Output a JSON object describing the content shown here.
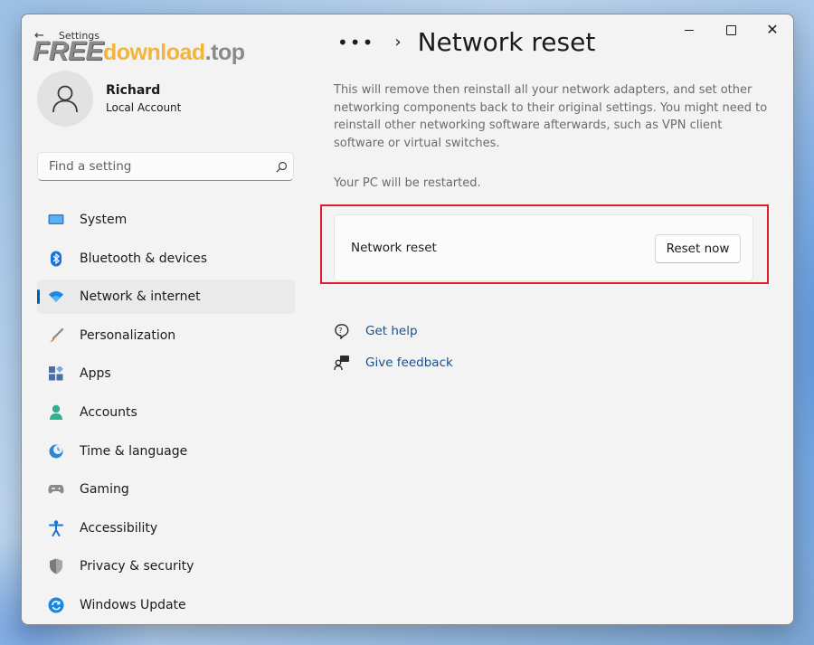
{
  "window": {
    "title": "Settings"
  },
  "watermark": {
    "part1": "FREE",
    "part2": "download",
    "part3": ".top"
  },
  "profile": {
    "name": "Richard",
    "account_type": "Local Account"
  },
  "search": {
    "placeholder": "Find a setting"
  },
  "sidebar": {
    "items": [
      {
        "label": "System",
        "icon": "system-icon",
        "color": "#2f7fd0"
      },
      {
        "label": "Bluetooth & devices",
        "icon": "bluetooth-icon",
        "color": "#1a73d9"
      },
      {
        "label": "Network & internet",
        "icon": "wifi-icon",
        "color": "#1a86e0",
        "active": true
      },
      {
        "label": "Personalization",
        "icon": "brush-icon",
        "color": "#d87a3a"
      },
      {
        "label": "Apps",
        "icon": "apps-icon",
        "color": "#4a6fa8"
      },
      {
        "label": "Accounts",
        "icon": "accounts-icon",
        "color": "#2fb08f"
      },
      {
        "label": "Time & language",
        "icon": "clock-globe-icon",
        "color": "#2a86d6"
      },
      {
        "label": "Gaming",
        "icon": "gamepad-icon",
        "color": "#8a8a8a"
      },
      {
        "label": "Accessibility",
        "icon": "accessibility-icon",
        "color": "#1a73d9"
      },
      {
        "label": "Privacy & security",
        "icon": "shield-icon",
        "color": "#777777"
      },
      {
        "label": "Windows Update",
        "icon": "update-icon",
        "color": "#1a86e0"
      }
    ]
  },
  "breadcrumb": {
    "overflow": "•••",
    "separator": "›"
  },
  "main": {
    "title": "Network reset",
    "description": "This will remove then reinstall all your network adapters, and set other networking components back to their original settings. You might need to reinstall other networking software afterwards, such as VPN client software or virtual switches.",
    "restart_note": "Your PC will be restarted.",
    "card": {
      "label": "Network reset",
      "button": "Reset now"
    },
    "links": [
      {
        "label": "Get help",
        "icon": "help-icon"
      },
      {
        "label": "Give feedback",
        "icon": "feedback-icon"
      }
    ]
  },
  "accent_color": "#005fb8",
  "highlight_color": "#e21d2b"
}
